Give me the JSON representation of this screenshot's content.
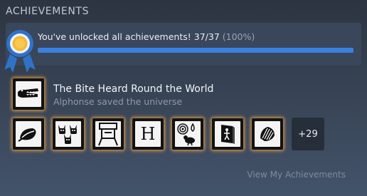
{
  "section": {
    "title": "ACHIEVEMENTS"
  },
  "summary": {
    "text": "You've unlocked all achievements! 37/37",
    "percent_text": "(100%)",
    "progress_fraction": 1.0
  },
  "featured": {
    "icon": "alligator-icon",
    "name": "The Bite Heard Round the World",
    "description": "Alphonse saved the universe"
  },
  "grid": {
    "icons": [
      "leaf-icon",
      "cats-icon",
      "robot-head-icon",
      "letter-h-icon",
      "bird-drop-icon",
      "book-figure-icon",
      "shell-icon"
    ],
    "h_letter": "H",
    "more_label": "+29"
  },
  "footer": {
    "link_label": "View My Achievements"
  },
  "colors": {
    "accent": "#3b81e0",
    "glow": "#f0a446",
    "ribbon": "#2f73c9",
    "medal": "#f7b733"
  }
}
